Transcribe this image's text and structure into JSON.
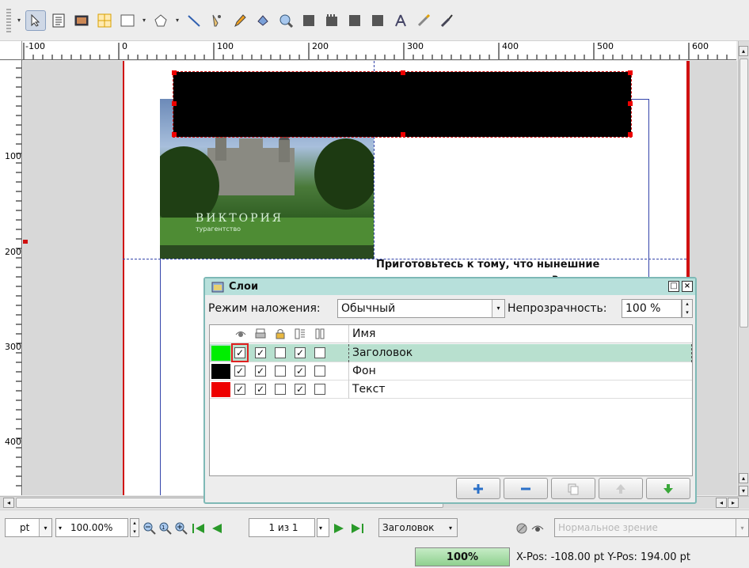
{
  "toolbar": {
    "tools": [
      "select-tool",
      "text-frame-tool",
      "image-frame-tool",
      "table-tool",
      "shape-tool",
      "polygon-tool",
      "line-tool",
      "bezier-tool",
      "freehand-tool",
      "rotate-tool",
      "zoom-tool",
      "edit-contents-tool",
      "link-frames-tool",
      "unlink-frames-tool",
      "copy-properties-tool",
      "measure-tool",
      "eyedropper-tool"
    ]
  },
  "ruler": {
    "h_labels": [
      "-100",
      "0",
      "100",
      "200",
      "300",
      "400",
      "500",
      "600"
    ],
    "v_labels": [
      "100",
      "200",
      "300",
      "400"
    ]
  },
  "page": {
    "text_snippet": "Приготовьтесь к тому, что нынешние",
    "text_snippet2": "в",
    "logo_text": "ВИКТОРИЯ",
    "logo_sub": "турагентство"
  },
  "layers_dialog": {
    "title": "Слои",
    "blend_label": "Режим наложения:",
    "blend_value": "Обычный",
    "opacity_label": "Непрозрачность:",
    "opacity_value": "100 %",
    "name_header": "Имя",
    "layers": [
      {
        "name": "Заголовок",
        "color": "#00ee00",
        "visible": true,
        "print": true,
        "lock": false,
        "flow": true,
        "outline": false
      },
      {
        "name": "Фон",
        "color": "#000000",
        "visible": true,
        "print": true,
        "lock": false,
        "flow": true,
        "outline": false
      },
      {
        "name": "Текст",
        "color": "#ee0000",
        "visible": true,
        "print": true,
        "lock": false,
        "flow": true,
        "outline": false
      }
    ]
  },
  "statusbar": {
    "unit": "pt",
    "zoom": "100.00%",
    "page_indicator": "1 из 1",
    "layer": "Заголовок",
    "view_mode": "Нормальное зрение",
    "progress": "100%",
    "coords": "X-Pos: -108.00 pt  Y-Pos: 194.00 pt"
  }
}
